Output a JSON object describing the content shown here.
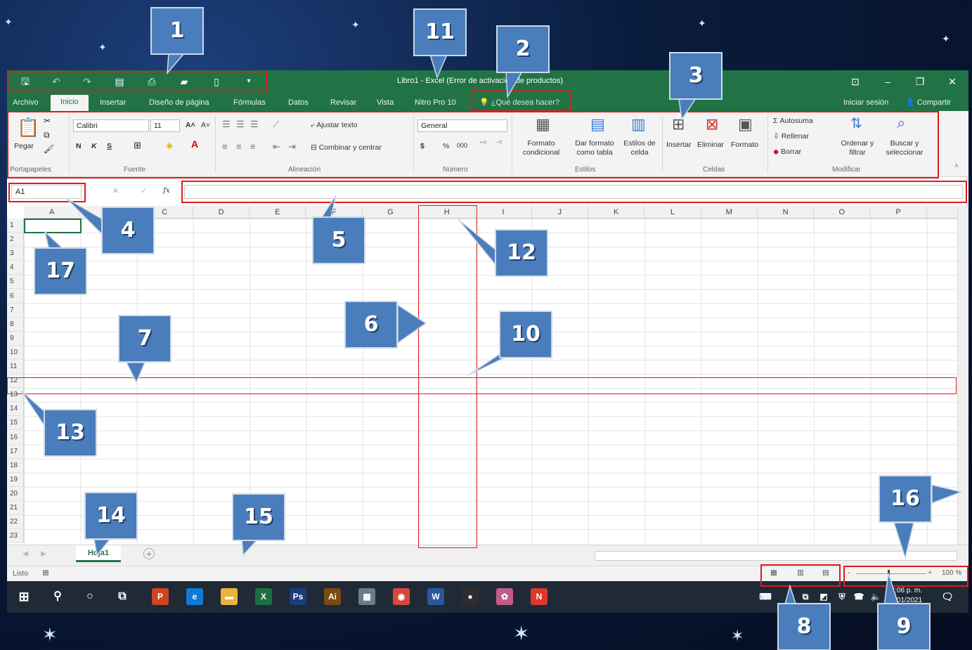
{
  "window": {
    "title": "Libro1 - Excel (Error de activación de productos)",
    "accent": "#217346",
    "controls": [
      "⊡",
      "–",
      "❐",
      "✕"
    ]
  },
  "quick_access": {
    "icons": [
      "save-icon",
      "undo-icon",
      "redo-icon",
      "form-icon",
      "print-preview-icon",
      "open-icon",
      "new-icon",
      "customize-icon"
    ]
  },
  "tabs": [
    "Archivo",
    "Inicio",
    "Insertar",
    "Diseño de página",
    "Fórmulas",
    "Datos",
    "Revisar",
    "Vista",
    "Nitro Pro 10"
  ],
  "tell_me": "¿Qué desea hacer?",
  "sign_in": "Iniciar sesión",
  "share": "Compartir",
  "ribbon": {
    "clipboard": {
      "paste": "Pegar",
      "group": "Portapapeles"
    },
    "font": {
      "name": "Calibri",
      "size": "11",
      "bold": "N",
      "italic": "K",
      "underline": "S",
      "group": "Fuente"
    },
    "alignment": {
      "wrap": "Ajustar texto",
      "merge": "Combinar y centrar",
      "group": "Alineación"
    },
    "number": {
      "format": "General",
      "currency": "$",
      "percent": "%",
      "thousands": "000",
      "group": "Número"
    },
    "styles": {
      "conditional": "Formato condicional",
      "as_table": "Dar formato como tabla",
      "cell_styles": "Estilos de celda",
      "group": "Estilos"
    },
    "cells": {
      "insert": "Insertar",
      "delete": "Eliminar",
      "format": "Formato",
      "group": "Celdas"
    },
    "editing": {
      "autosum": "Autosuma",
      "fill": "Rellenar",
      "clear": "Borrar",
      "sort": "Ordenar y filtrar",
      "find": "Buscar y seleccionar",
      "group": "Modificar"
    }
  },
  "name_box": "A1",
  "fx": "fx",
  "columns": [
    "A",
    "B",
    "C",
    "D",
    "E",
    "F",
    "G",
    "H",
    "I",
    "J",
    "K",
    "L",
    "M",
    "N",
    "O",
    "P"
  ],
  "rows": [
    "1",
    "2",
    "3",
    "4",
    "5",
    "6",
    "7",
    "8",
    "9",
    "10",
    "11",
    "12",
    "13",
    "14",
    "15",
    "16",
    "17",
    "18",
    "19",
    "20",
    "21",
    "22",
    "23"
  ],
  "sheet": {
    "tab": "Hoja1",
    "add": "+"
  },
  "status": {
    "ready": "Listo",
    "zoom": "100 %",
    "zoom_minus": "-",
    "zoom_plus": "+"
  },
  "taskbar": {
    "clock": "04:06 p. m.",
    "date": "15/01/2021",
    "apps": [
      {
        "label": "P",
        "color": "#d04423"
      },
      {
        "label": "e",
        "color": "#0f7bd6"
      },
      {
        "label": "▬",
        "color": "#e8b53a"
      },
      {
        "label": "X",
        "color": "#1d6f42"
      },
      {
        "label": "Ps",
        "color": "#1b3d78"
      },
      {
        "label": "Ai",
        "color": "#7a4a10"
      },
      {
        "label": "▦",
        "color": "#6a7d8c"
      },
      {
        "label": "◉",
        "color": "#d4483b"
      },
      {
        "label": "W",
        "color": "#2b579a"
      },
      {
        "label": "●",
        "color": "#2e2e2e"
      },
      {
        "label": "✿",
        "color": "#c25a8a"
      },
      {
        "label": "N",
        "color": "#e0372b"
      }
    ]
  },
  "callouts": [
    "1",
    "2",
    "3",
    "4",
    "5",
    "6",
    "7",
    "8",
    "9",
    "10",
    "11",
    "12",
    "13",
    "14",
    "15",
    "16",
    "17"
  ]
}
